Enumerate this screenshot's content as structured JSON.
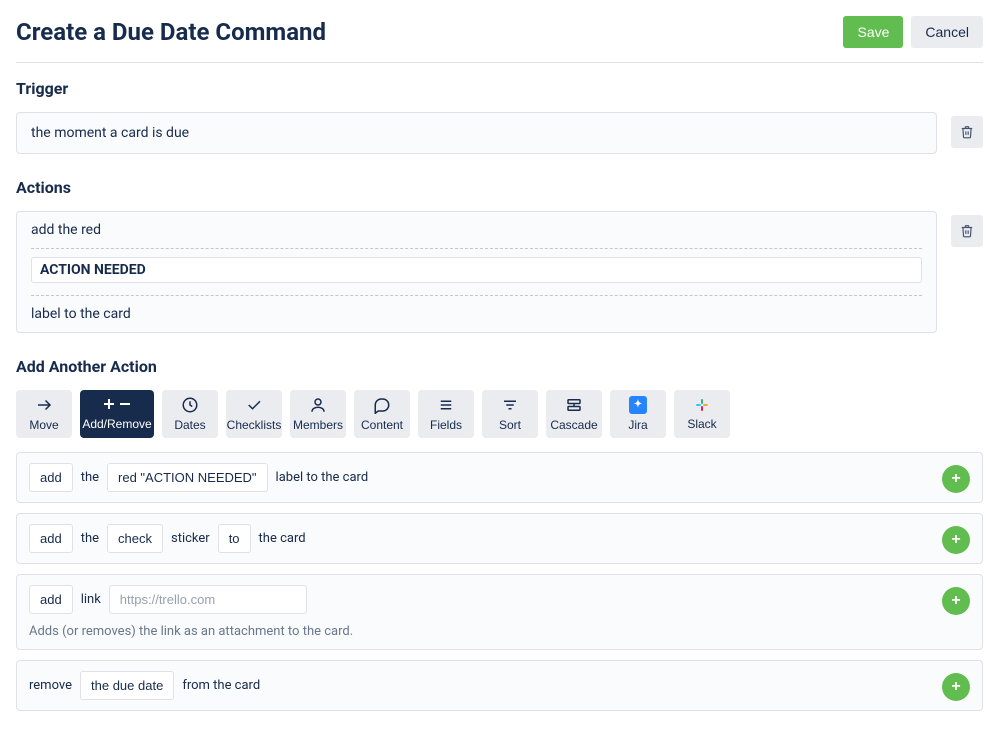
{
  "header": {
    "title": "Create a Due Date Command",
    "save_label": "Save",
    "cancel_label": "Cancel"
  },
  "trigger": {
    "heading": "Trigger",
    "text": "the moment a card is due"
  },
  "actions": {
    "heading": "Actions",
    "pre_text": "add the red",
    "tag_value": "ACTION NEEDED",
    "post_text": "label to the card"
  },
  "add_another": {
    "heading": "Add Another Action"
  },
  "tabs": [
    {
      "id": "move",
      "label": "Move"
    },
    {
      "id": "add-remove",
      "label": "Add/Remove",
      "active": true
    },
    {
      "id": "dates",
      "label": "Dates"
    },
    {
      "id": "checklists",
      "label": "Checklists"
    },
    {
      "id": "members",
      "label": "Members"
    },
    {
      "id": "content",
      "label": "Content"
    },
    {
      "id": "fields",
      "label": "Fields"
    },
    {
      "id": "sort",
      "label": "Sort"
    },
    {
      "id": "cascade",
      "label": "Cascade"
    },
    {
      "id": "jira",
      "label": "Jira"
    },
    {
      "id": "slack",
      "label": "Slack"
    }
  ],
  "templates": {
    "label": {
      "verb": "add",
      "t1": "the",
      "value": "red \"ACTION NEEDED\"",
      "t2": "label to the card"
    },
    "sticker": {
      "verb": "add",
      "t1": "the",
      "value": "check",
      "t2": "sticker",
      "pos": "to",
      "t3": "the card"
    },
    "link": {
      "verb": "add",
      "t1": "link",
      "placeholder": "https://trello.com",
      "hint": "Adds (or removes) the link as an attachment to the card."
    },
    "duedate": {
      "verb": "remove",
      "value": "the due date",
      "t1": "from the card"
    }
  }
}
